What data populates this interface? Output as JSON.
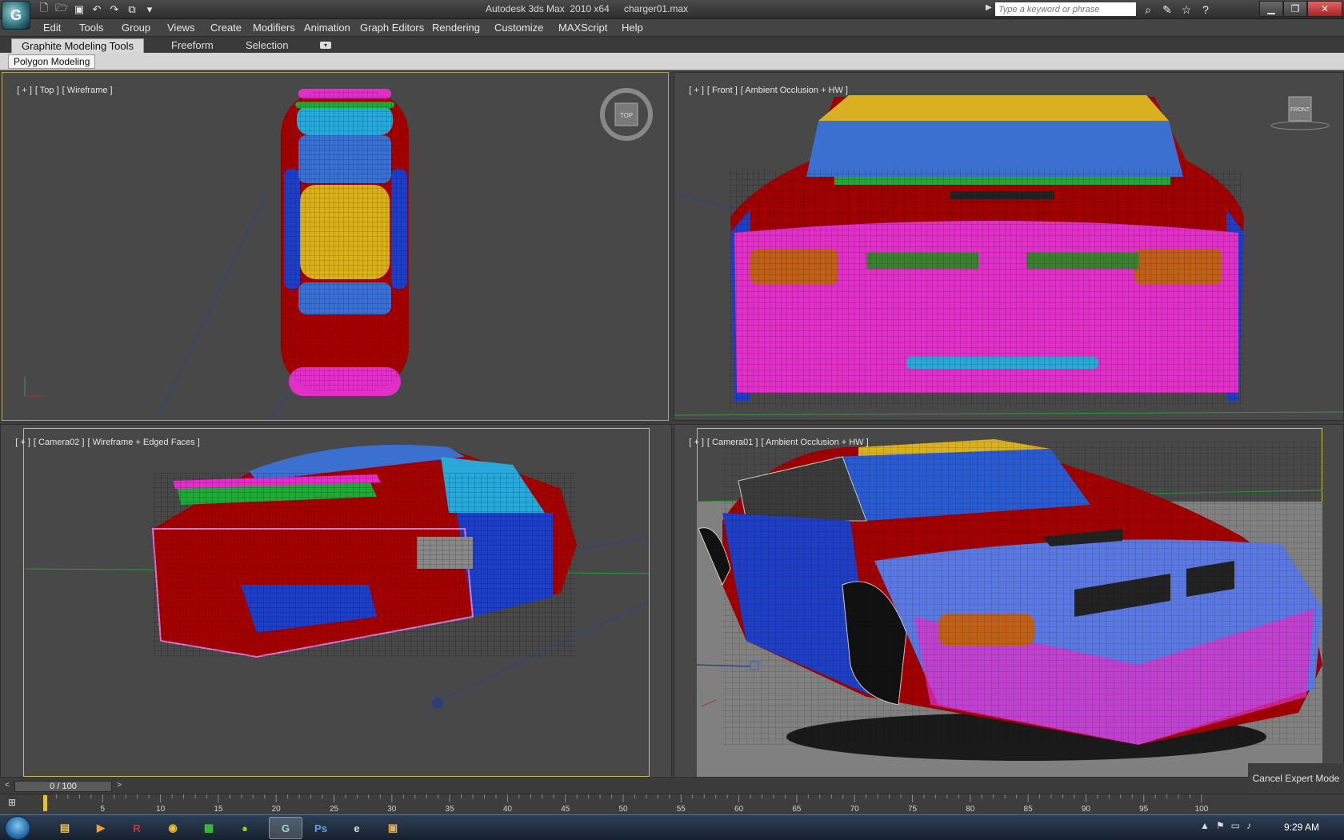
{
  "titlebar": {
    "app_title": "Autodesk 3ds Max  2010 x64",
    "file_name": "charger01.max",
    "search_placeholder": "Type a keyword or phrase",
    "logo_letter": "G"
  },
  "menu": [
    "Edit",
    "Tools",
    "Group",
    "Views",
    "Create",
    "Modifiers",
    "Animation",
    "Graph Editors",
    "Rendering",
    "Customize",
    "MAXScript",
    "Help"
  ],
  "ribbon": {
    "tabs": [
      "Graphite Modeling Tools",
      "Freeform",
      "Selection"
    ],
    "panel": "Polygon Modeling"
  },
  "viewports": {
    "top": {
      "label": [
        "[ + ]",
        "[ Top ]",
        "[ Wireframe ]"
      ],
      "cube_label": "TOP"
    },
    "front": {
      "label": [
        "[ + ]",
        "[ Front ]",
        "[ Ambient Occlusion + HW ]"
      ],
      "cube_label": "FRONT"
    },
    "cam2": {
      "label": [
        "[ + ]",
        "[ Camera02 ]",
        "[ Wireframe + Edged Faces ]"
      ]
    },
    "cam1": {
      "label": [
        "[ + ]",
        "[ Camera01 ]",
        "[ Ambient Occlusion + HW ]"
      ]
    }
  },
  "timeline": {
    "slider_text": "0 / 100",
    "ticks": [
      "5",
      "10",
      "15",
      "20",
      "25",
      "30",
      "35",
      "40",
      "45",
      "50",
      "55",
      "60",
      "65",
      "70",
      "75",
      "80",
      "85",
      "90",
      "95",
      "100"
    ],
    "cancel_expert": "Cancel Expert Mode"
  },
  "taskbar": {
    "clock": "9:29 AM"
  },
  "colors": {
    "red": "#a00000",
    "blue": "#1e3fc4",
    "green": "#22a838",
    "magenta": "#e030c8",
    "yellow": "#d8b020",
    "cyan": "#2aa8d8"
  }
}
